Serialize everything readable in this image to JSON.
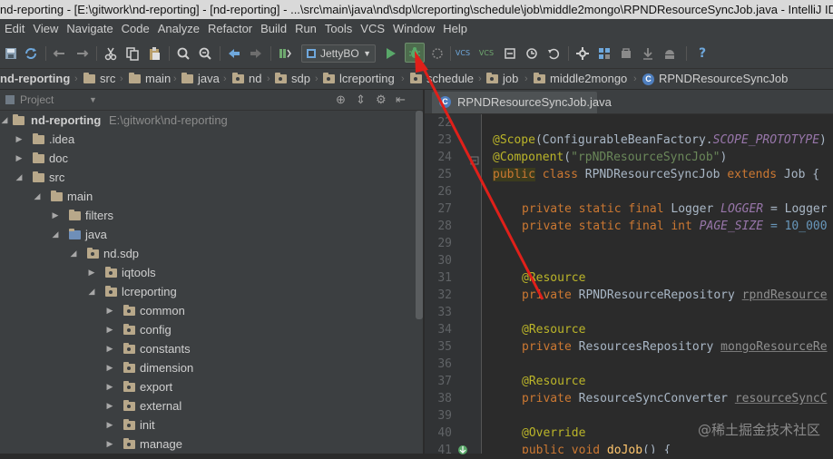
{
  "window": {
    "title": "nd-reporting - [E:\\gitwork\\nd-reporting] - [nd-reporting] - ...\\src\\main\\java\\nd\\sdp\\lcreporting\\schedule\\job\\middle2mongo\\RPNDResourceSyncJob.java - IntelliJ IDEA"
  },
  "menu": {
    "items": [
      {
        "label": "Edit"
      },
      {
        "label": "View"
      },
      {
        "label": "Navigate"
      },
      {
        "label": "Code"
      },
      {
        "label": "Analyze"
      },
      {
        "label": "Refactor"
      },
      {
        "label": "Build"
      },
      {
        "label": "Run"
      },
      {
        "label": "Tools"
      },
      {
        "label": "VCS"
      },
      {
        "label": "Window"
      },
      {
        "label": "Help"
      }
    ]
  },
  "toolbar": {
    "run_config": "JettyBO",
    "help": "?",
    "vcs": "VCS"
  },
  "breadcrumbs": {
    "items": [
      {
        "label": "nd-reporting"
      },
      {
        "label": "src"
      },
      {
        "label": "main"
      },
      {
        "label": "java"
      },
      {
        "label": "nd"
      },
      {
        "label": "sdp"
      },
      {
        "label": "lcreporting"
      },
      {
        "label": "schedule"
      },
      {
        "label": "job"
      },
      {
        "label": "middle2mongo"
      },
      {
        "label": "RPNDResourceSyncJob"
      }
    ],
    "class_icon": "C"
  },
  "project": {
    "header": "Project",
    "root_label": "nd-reporting",
    "root_path": "E:\\gitwork\\nd-reporting",
    "tree": [
      {
        "label": ".idea"
      },
      {
        "label": "doc"
      },
      {
        "label": "src"
      },
      {
        "label": "main"
      },
      {
        "label": "filters"
      },
      {
        "label": "java"
      },
      {
        "label": "nd.sdp"
      },
      {
        "label": "iqtools"
      },
      {
        "label": "lcreporting"
      },
      {
        "label": "common"
      },
      {
        "label": "config"
      },
      {
        "label": "constants"
      },
      {
        "label": "dimension"
      },
      {
        "label": "export"
      },
      {
        "label": "external"
      },
      {
        "label": "init"
      },
      {
        "label": "manage"
      }
    ]
  },
  "editor": {
    "tab": "RPNDResourceSyncJob.java",
    "line_numbers": [
      "22",
      "23",
      "24",
      "25",
      "26",
      "27",
      "28",
      "29",
      "30",
      "31",
      "32",
      "33",
      "34",
      "35",
      "36",
      "37",
      "38",
      "39",
      "40",
      "41"
    ],
    "tokens": {
      "scope_ann": "@Scope",
      "scope_open": "(ConfigurableBeanFactory.",
      "scope_const": "SCOPE_PROTOTYPE",
      "scope_close": ")",
      "comp_ann": "@Component",
      "comp_open": "(",
      "comp_str": "\"rpNDResourceSyncJob\"",
      "comp_close": ")",
      "l25_public": "public",
      "l25_class": " class ",
      "l25_name": "RPNDResourceSyncJob ",
      "l25_extends": "extends",
      "l25_rest": " Job {",
      "l27_mods": "private static final ",
      "l27_type": "Logger ",
      "l27_field": "LOGGER",
      "l27_rest": " = Logger",
      "l28_mods": "private static final int ",
      "l28_field": "PAGE_SIZE",
      "l28_rest": " = 10_000",
      "l31_ann": "@Resource",
      "l32_priv": "private ",
      "l32_type": "RPNDResourceRepository ",
      "l32_field": "rpndResource",
      "l34_ann": "@Resource",
      "l35_priv": "private ",
      "l35_type": "ResourcesRepository ",
      "l35_field": "mongoResourceRe",
      "l37_ann": "@Resource",
      "l38_priv": "private ",
      "l38_type": "ResourceSyncConverter ",
      "l38_field": "resourceSyncC",
      "l40_ann": "@Override",
      "l41_kw": "public void ",
      "l41_name": "doJob",
      "l41_rest": "() {"
    }
  },
  "watermark": "@稀土掘金技术社区"
}
